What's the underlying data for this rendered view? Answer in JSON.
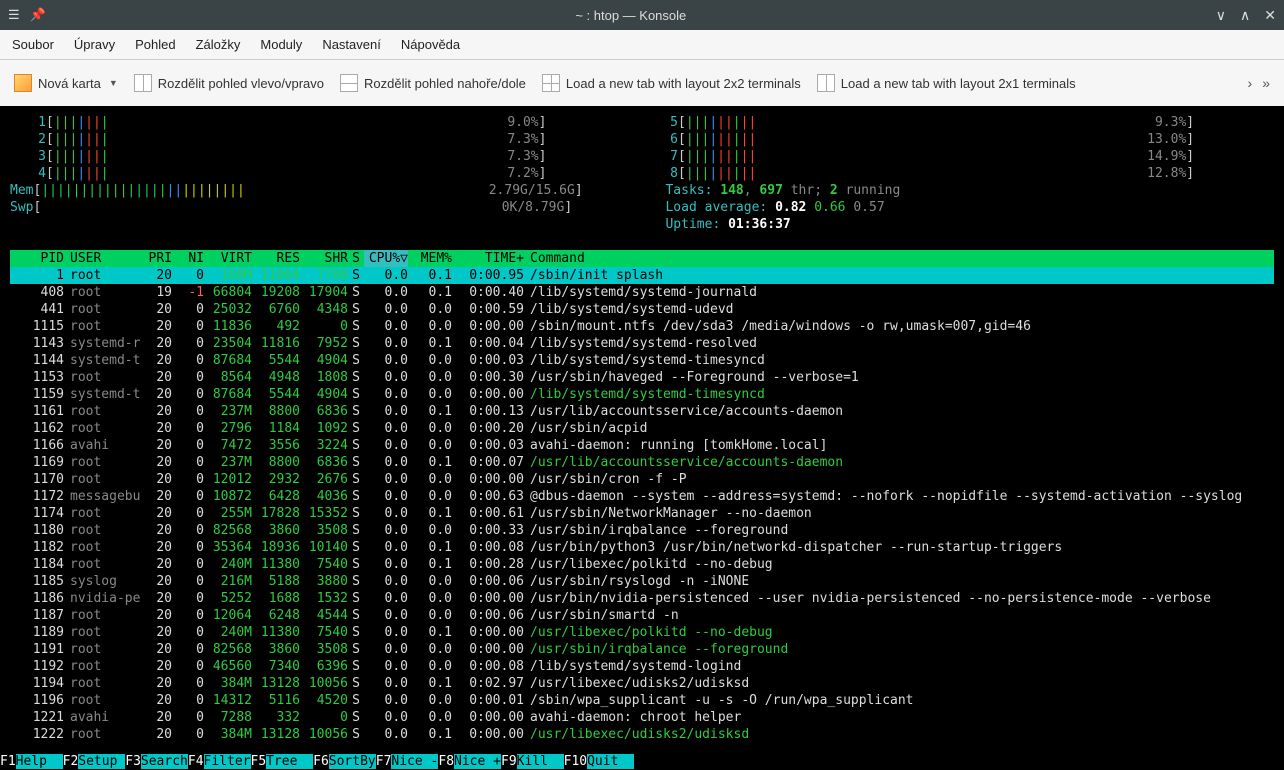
{
  "window": {
    "title": "~ : htop — Konsole"
  },
  "menubar": [
    "Soubor",
    "Úpravy",
    "Pohled",
    "Záložky",
    "Moduly",
    "Nastavení",
    "Nápověda"
  ],
  "toolbar": {
    "newtab": "Nová karta",
    "split_lr": "Rozdělit pohled vlevo/vpravo",
    "split_tb": "Rozdělit pohled nahoře/dole",
    "layout2x2": "Load a new tab with layout 2x2 terminals",
    "layout2x1": "Load a new tab with layout 2x1 terminals"
  },
  "cpus_left": [
    {
      "n": "1",
      "pct": "9.0%"
    },
    {
      "n": "2",
      "pct": "7.3%"
    },
    {
      "n": "3",
      "pct": "7.3%"
    },
    {
      "n": "4",
      "pct": "7.2%"
    }
  ],
  "cpus_right": [
    {
      "n": "5",
      "pct": "9.3%"
    },
    {
      "n": "6",
      "pct": "13.0%"
    },
    {
      "n": "7",
      "pct": "14.9%"
    },
    {
      "n": "8",
      "pct": "12.8%"
    }
  ],
  "mem": {
    "label": "Mem",
    "val": "2.79G/15.6G"
  },
  "swp": {
    "label": "Swp",
    "val": "0K/8.79G"
  },
  "tasks": {
    "label": "Tasks:",
    "procs": "148",
    "thr": "697",
    "thr_lbl": "thr;",
    "run": "2",
    "run_lbl": "running"
  },
  "load": {
    "label": "Load average:",
    "v1": "0.82",
    "v2": "0.66",
    "v3": "0.57"
  },
  "uptime": {
    "label": "Uptime:",
    "val": "01:36:37"
  },
  "headers": {
    "pid": "PID",
    "user": "USER",
    "pri": "PRI",
    "ni": "NI",
    "virt": "VIRT",
    "res": "RES",
    "shr": "SHR",
    "s": "S",
    "cpu": "CPU%",
    "mem": "MEM%",
    "time": "TIME+",
    "cmd": "Command"
  },
  "procs": [
    {
      "sel": true,
      "pid": "1",
      "user": "root",
      "pri": "20",
      "ni": "0",
      "virt": "160M",
      "res": "11064",
      "shr": "7708",
      "s": "S",
      "cpu": "0.0",
      "mem": "0.1",
      "time": "0:00.95",
      "cmd": "/sbin/init splash"
    },
    {
      "pid": "408",
      "user": "root",
      "pri": "19",
      "ni": "-1",
      "ni_red": true,
      "virt": "66804",
      "res": "19208",
      "shr": "17904",
      "s": "S",
      "cpu": "0.0",
      "mem": "0.1",
      "time": "0:00.40",
      "cmd": "/lib/systemd/systemd-journald"
    },
    {
      "pid": "441",
      "user": "root",
      "pri": "20",
      "ni": "0",
      "virt": "25032",
      "res": "6760",
      "shr": "4348",
      "s": "S",
      "cpu": "0.0",
      "mem": "0.0",
      "time": "0:00.59",
      "cmd": "/lib/systemd/systemd-udevd"
    },
    {
      "pid": "1115",
      "user": "root",
      "pri": "20",
      "ni": "0",
      "virt": "11836",
      "res": "492",
      "shr": "0",
      "s": "S",
      "cpu": "0.0",
      "mem": "0.0",
      "time": "0:00.00",
      "cmd": "/sbin/mount.ntfs /dev/sda3 /media/windows -o rw,umask=007,gid=46"
    },
    {
      "pid": "1143",
      "user": "systemd-r",
      "pri": "20",
      "ni": "0",
      "virt": "23504",
      "res": "11816",
      "shr": "7952",
      "s": "S",
      "cpu": "0.0",
      "mem": "0.1",
      "time": "0:00.04",
      "cmd": "/lib/systemd/systemd-resolved"
    },
    {
      "pid": "1144",
      "user": "systemd-t",
      "pri": "20",
      "ni": "0",
      "virt": "87684",
      "res": "5544",
      "shr": "4904",
      "s": "S",
      "cpu": "0.0",
      "mem": "0.0",
      "time": "0:00.03",
      "cmd": "/lib/systemd/systemd-timesyncd"
    },
    {
      "pid": "1153",
      "user": "root",
      "pri": "20",
      "ni": "0",
      "virt": "8564",
      "res": "4948",
      "shr": "1808",
      "s": "S",
      "cpu": "0.0",
      "mem": "0.0",
      "time": "0:00.30",
      "cmd": "/usr/sbin/haveged --Foreground --verbose=1"
    },
    {
      "pid": "1159",
      "user": "systemd-t",
      "pri": "20",
      "ni": "0",
      "virt": "87684",
      "res": "5544",
      "shr": "4904",
      "s": "S",
      "cpu": "0.0",
      "mem": "0.0",
      "time": "0:00.00",
      "cmd": "/lib/systemd/systemd-timesyncd",
      "green": true
    },
    {
      "pid": "1161",
      "user": "root",
      "pri": "20",
      "ni": "0",
      "virt": "237M",
      "res": "8800",
      "shr": "6836",
      "s": "S",
      "cpu": "0.0",
      "mem": "0.1",
      "time": "0:00.13",
      "cmd": "/usr/lib/accountsservice/accounts-daemon"
    },
    {
      "pid": "1162",
      "user": "root",
      "pri": "20",
      "ni": "0",
      "virt": "2796",
      "res": "1184",
      "shr": "1092",
      "s": "S",
      "cpu": "0.0",
      "mem": "0.0",
      "time": "0:00.20",
      "cmd": "/usr/sbin/acpid"
    },
    {
      "pid": "1166",
      "user": "avahi",
      "pri": "20",
      "ni": "0",
      "virt": "7472",
      "res": "3556",
      "shr": "3224",
      "s": "S",
      "cpu": "0.0",
      "mem": "0.0",
      "time": "0:00.03",
      "cmd": "avahi-daemon: running [tomkHome.local]"
    },
    {
      "pid": "1169",
      "user": "root",
      "pri": "20",
      "ni": "0",
      "virt": "237M",
      "res": "8800",
      "shr": "6836",
      "s": "S",
      "cpu": "0.0",
      "mem": "0.1",
      "time": "0:00.07",
      "cmd": "/usr/lib/accountsservice/accounts-daemon",
      "green": true
    },
    {
      "pid": "1170",
      "user": "root",
      "pri": "20",
      "ni": "0",
      "virt": "12012",
      "res": "2932",
      "shr": "2676",
      "s": "S",
      "cpu": "0.0",
      "mem": "0.0",
      "time": "0:00.00",
      "cmd": "/usr/sbin/cron -f -P"
    },
    {
      "pid": "1172",
      "user": "messagebu",
      "pri": "20",
      "ni": "0",
      "virt": "10872",
      "res": "6428",
      "shr": "4036",
      "s": "S",
      "cpu": "0.0",
      "mem": "0.0",
      "time": "0:00.63",
      "cmd": "@dbus-daemon --system --address=systemd: --nofork --nopidfile --systemd-activation --syslog"
    },
    {
      "pid": "1174",
      "user": "root",
      "pri": "20",
      "ni": "0",
      "virt": "255M",
      "res": "17828",
      "shr": "15352",
      "s": "S",
      "cpu": "0.0",
      "mem": "0.1",
      "time": "0:00.61",
      "cmd": "/usr/sbin/NetworkManager --no-daemon"
    },
    {
      "pid": "1180",
      "user": "root",
      "pri": "20",
      "ni": "0",
      "virt": "82568",
      "res": "3860",
      "shr": "3508",
      "s": "S",
      "cpu": "0.0",
      "mem": "0.0",
      "time": "0:00.33",
      "cmd": "/usr/sbin/irqbalance --foreground"
    },
    {
      "pid": "1182",
      "user": "root",
      "pri": "20",
      "ni": "0",
      "virt": "35364",
      "res": "18936",
      "shr": "10140",
      "s": "S",
      "cpu": "0.0",
      "mem": "0.1",
      "time": "0:00.08",
      "cmd": "/usr/bin/python3 /usr/bin/networkd-dispatcher --run-startup-triggers"
    },
    {
      "pid": "1184",
      "user": "root",
      "pri": "20",
      "ni": "0",
      "virt": "240M",
      "res": "11380",
      "shr": "7540",
      "s": "S",
      "cpu": "0.0",
      "mem": "0.1",
      "time": "0:00.28",
      "cmd": "/usr/libexec/polkitd --no-debug"
    },
    {
      "pid": "1185",
      "user": "syslog",
      "pri": "20",
      "ni": "0",
      "virt": "216M",
      "res": "5188",
      "shr": "3880",
      "s": "S",
      "cpu": "0.0",
      "mem": "0.0",
      "time": "0:00.06",
      "cmd": "/usr/sbin/rsyslogd -n -iNONE"
    },
    {
      "pid": "1186",
      "user": "nvidia-pe",
      "pri": "20",
      "ni": "0",
      "virt": "5252",
      "res": "1688",
      "shr": "1532",
      "s": "S",
      "cpu": "0.0",
      "mem": "0.0",
      "time": "0:00.00",
      "cmd": "/usr/bin/nvidia-persistenced --user nvidia-persistenced --no-persistence-mode --verbose"
    },
    {
      "pid": "1187",
      "user": "root",
      "pri": "20",
      "ni": "0",
      "virt": "12064",
      "res": "6248",
      "shr": "4544",
      "s": "S",
      "cpu": "0.0",
      "mem": "0.0",
      "time": "0:00.06",
      "cmd": "/usr/sbin/smartd -n"
    },
    {
      "pid": "1189",
      "user": "root",
      "pri": "20",
      "ni": "0",
      "virt": "240M",
      "res": "11380",
      "shr": "7540",
      "s": "S",
      "cpu": "0.0",
      "mem": "0.1",
      "time": "0:00.00",
      "cmd": "/usr/libexec/polkitd --no-debug",
      "green": true
    },
    {
      "pid": "1191",
      "user": "root",
      "pri": "20",
      "ni": "0",
      "virt": "82568",
      "res": "3860",
      "shr": "3508",
      "s": "S",
      "cpu": "0.0",
      "mem": "0.0",
      "time": "0:00.00",
      "cmd": "/usr/sbin/irqbalance --foreground",
      "green": true
    },
    {
      "pid": "1192",
      "user": "root",
      "pri": "20",
      "ni": "0",
      "virt": "46560",
      "res": "7340",
      "shr": "6396",
      "s": "S",
      "cpu": "0.0",
      "mem": "0.0",
      "time": "0:00.08",
      "cmd": "/lib/systemd/systemd-logind"
    },
    {
      "pid": "1194",
      "user": "root",
      "pri": "20",
      "ni": "0",
      "virt": "384M",
      "res": "13128",
      "shr": "10056",
      "s": "S",
      "cpu": "0.0",
      "mem": "0.1",
      "time": "0:02.97",
      "cmd": "/usr/libexec/udisks2/udisksd"
    },
    {
      "pid": "1196",
      "user": "root",
      "pri": "20",
      "ni": "0",
      "virt": "14312",
      "res": "5116",
      "shr": "4520",
      "s": "S",
      "cpu": "0.0",
      "mem": "0.0",
      "time": "0:00.01",
      "cmd": "/sbin/wpa_supplicant -u -s -O /run/wpa_supplicant"
    },
    {
      "pid": "1221",
      "user": "avahi",
      "pri": "20",
      "ni": "0",
      "virt": "7288",
      "res": "332",
      "shr": "0",
      "s": "S",
      "cpu": "0.0",
      "mem": "0.0",
      "time": "0:00.00",
      "cmd": "avahi-daemon: chroot helper"
    },
    {
      "pid": "1222",
      "user": "root",
      "pri": "20",
      "ni": "0",
      "virt": "384M",
      "res": "13128",
      "shr": "10056",
      "s": "S",
      "cpu": "0.0",
      "mem": "0.1",
      "time": "0:00.00",
      "cmd": "/usr/libexec/udisks2/udisksd",
      "green": true
    }
  ],
  "fn": [
    {
      "k": "F1",
      "l": "Help  "
    },
    {
      "k": "F2",
      "l": "Setup "
    },
    {
      "k": "F3",
      "l": "Search"
    },
    {
      "k": "F4",
      "l": "Filter"
    },
    {
      "k": "F5",
      "l": "Tree  "
    },
    {
      "k": "F6",
      "l": "SortBy"
    },
    {
      "k": "F7",
      "l": "Nice -"
    },
    {
      "k": "F8",
      "l": "Nice +"
    },
    {
      "k": "F9",
      "l": "Kill  "
    },
    {
      "k": "F10",
      "l": "Quit  "
    }
  ]
}
